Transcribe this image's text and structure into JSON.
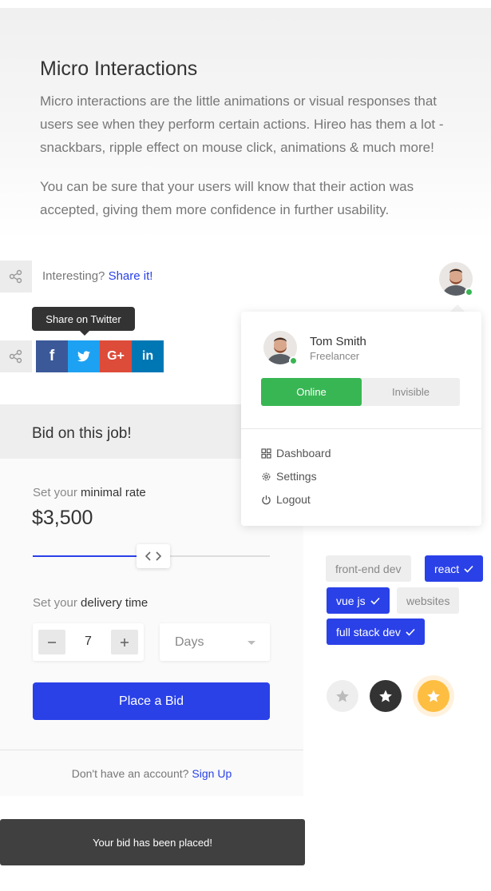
{
  "hero": {
    "title": "Micro Interactions",
    "paragraph_1": "Micro interactions are the little animations or visual responses that users see when they perform certain actions. Hireo has them a lot - snackbars, ripple effect on mouse click, animations & much more!",
    "paragraph_2": "You can be sure that your users will know that their action was accepted, giving them more confidence in further usability."
  },
  "share": {
    "prompt": "Interesting?",
    "link": "Share it!",
    "tooltip": "Share on Twitter",
    "networks": [
      {
        "name": "facebook",
        "glyph": "f",
        "color": "#3b5998"
      },
      {
        "name": "twitter",
        "glyph": "t",
        "color": "#1da1f2"
      },
      {
        "name": "google-plus",
        "glyph": "G+",
        "color": "#dd4b39"
      },
      {
        "name": "linkedin",
        "glyph": "in",
        "color": "#0077b5"
      }
    ]
  },
  "bid": {
    "title": "Bid on this job!",
    "rate_label_prefix": "Set your",
    "rate_label_strong": "minimal rate",
    "rate_value": "$3,500",
    "rate_slider_fraction": 0.44,
    "delivery_label_prefix": "Set your",
    "delivery_label_strong": "delivery time",
    "quantity": "7",
    "unit": "Days",
    "submit_label": "Place a Bid",
    "footer_text": "Don't have an account?",
    "footer_link": "Sign Up"
  },
  "user_menu": {
    "name": "Tom Smith",
    "role": "Freelancer",
    "status_online": "Online",
    "status_invisible": "Invisible",
    "items": [
      "Dashboard",
      "Settings",
      "Logout"
    ]
  },
  "tags": [
    {
      "label": "front-end dev",
      "selected": false
    },
    {
      "label": "react",
      "selected": true
    },
    {
      "label": "vue js",
      "selected": true
    },
    {
      "label": "websites",
      "selected": false
    },
    {
      "label": "full stack dev",
      "selected": true
    }
  ],
  "snackbar": {
    "message": "Your bid has been placed!"
  },
  "colors": {
    "accent": "#2a41e8",
    "online": "#38b653",
    "bookmark_active": "#febe42"
  }
}
